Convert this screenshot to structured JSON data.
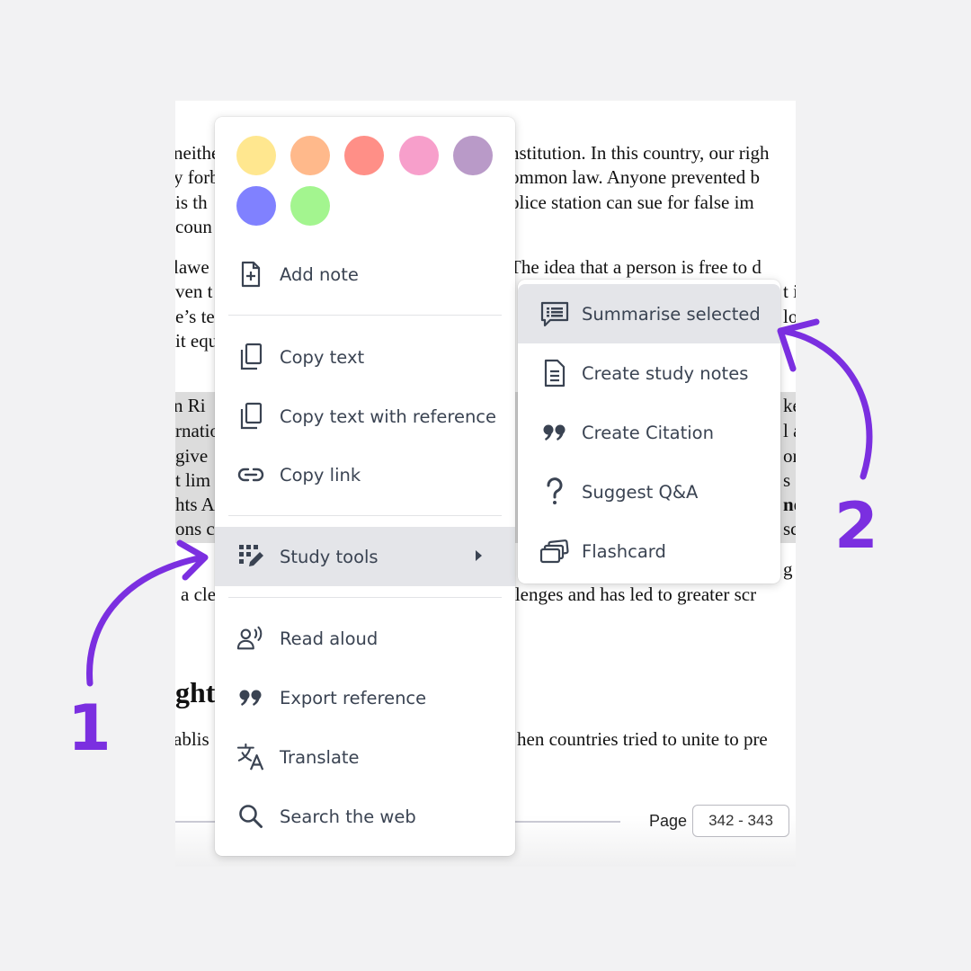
{
  "document": {
    "lines": [
      "neither ...                                   nstitution. In this country, our rights",
      "y forb...                                     ommon law. Anyone prevented b",
      "is th...                                      olice station can sue for false imp",
      "coun"
    ],
    "body_right_lines": [
      "nstitution. In this country, our righ",
      "ommon law. Anyone prevented b",
      "olice station can sue for false im",
      "The idea that a person is free to d",
      "llenges and has led to greater scr",
      "hen countries tried to unite to pre"
    ],
    "body_left_lines": [
      "neithe",
      "y forb",
      "is th",
      "coun",
      "lawe",
      "ven t",
      "e’s te",
      "it equ",
      "n Ri",
      "rnatio",
      "give",
      "t lim",
      "hts A",
      "ons c",
      "a cle",
      "ablis"
    ],
    "heading": "ghts",
    "right_fragments": [
      "t i",
      "lo",
      "ke",
      "l a",
      "or",
      "s",
      "nd",
      "sc",
      "g c"
    ],
    "page_label": "Page",
    "page_value": "342 - 343"
  },
  "menu": {
    "swatches": [
      "#ffe78f",
      "#ffb98b",
      "#ff8f87",
      "#f79fcb",
      "#b99ac8",
      "#8081ff",
      "#a3f58f"
    ],
    "add_note": "Add note",
    "copy_text": "Copy text",
    "copy_text_ref": "Copy text with reference",
    "copy_link": "Copy link",
    "study_tools": "Study tools",
    "read_aloud": "Read aloud",
    "export_reference": "Export reference",
    "translate": "Translate",
    "search_web": "Search the web"
  },
  "submenu": {
    "summarise": "Summarise selected",
    "study_notes": "Create study notes",
    "citation": "Create Citation",
    "suggest_qa": "Suggest Q&A",
    "flashcard": "Flashcard"
  },
  "annotations": {
    "step1": "1",
    "step2": "2",
    "accent_color": "#7b2fe0"
  }
}
